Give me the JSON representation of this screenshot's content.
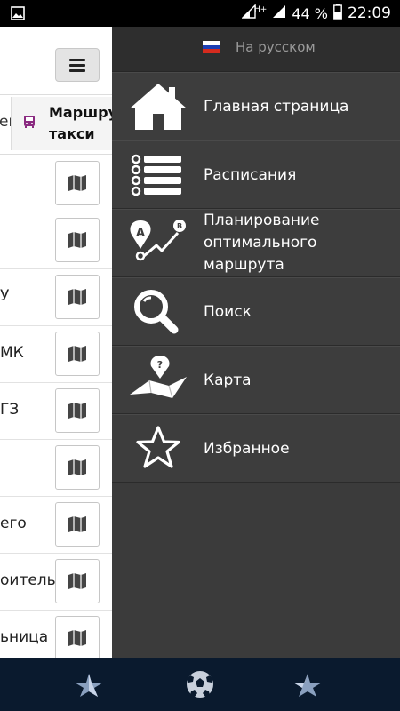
{
  "status_bar": {
    "network": "H+",
    "battery": "44 %",
    "time": "22:09"
  },
  "background_page": {
    "tabs": {
      "prev_partial": "ей",
      "active": "Маршрутные такси"
    },
    "rows": [
      "",
      "",
      "У",
      "МК",
      "ГЗ",
      "",
      "его",
      "оительн",
      "ьница"
    ]
  },
  "drawer": {
    "language_label": "На русском",
    "items": [
      {
        "label": "Главная страница",
        "icon": "home-icon"
      },
      {
        "label": "Расписания",
        "icon": "schedule-list-icon"
      },
      {
        "label": "Планирование оптимального маршрута",
        "icon": "route-planning-icon"
      },
      {
        "label": "Поиск",
        "icon": "search-icon"
      },
      {
        "label": "Карта",
        "icon": "map-pin-icon"
      },
      {
        "label": "Избранное",
        "icon": "star-icon"
      }
    ]
  },
  "bottom_nav": [
    "left-star-logo-icon",
    "ball-icon",
    "right-star-logo-icon"
  ],
  "colors": {
    "drawer_bg": "#3b3b3b",
    "bottom_nav_bg": "#0a1a2e",
    "bus_icon": "#8a2a80"
  }
}
